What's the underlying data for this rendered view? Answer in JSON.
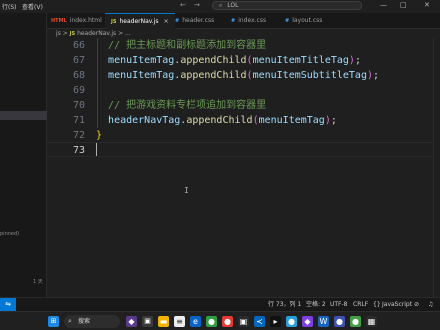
{
  "titlebar": {
    "menu_partial": "行(S)",
    "menu_view": "查看(V)",
    "nav_back": "←",
    "nav_forward": "→",
    "search_text": "LOL",
    "minimize": "—",
    "maximize": "□",
    "close": "✕"
  },
  "sidebar": {
    "label_partial": "pinned)",
    "date_label": "1 天"
  },
  "tabs": [
    {
      "icon": "HTML",
      "label": "index.html",
      "close": ""
    },
    {
      "icon": "JS",
      "label": "headerNav.js",
      "close": "×"
    },
    {
      "icon": "#",
      "label": "header.css",
      "close": ""
    },
    {
      "icon": "#",
      "label": "index.css",
      "close": ""
    },
    {
      "icon": "#",
      "label": "layout.css",
      "close": ""
    }
  ],
  "breadcrumb": {
    "folder": "js",
    "sep": ">",
    "file_icon": "JS",
    "file": "headerNav.js",
    "symbol": "> ..."
  },
  "editor": {
    "lines": [
      {
        "num": "66",
        "segments": [
          {
            "text": "  ",
            "cls": "pn"
          },
          {
            "text": "// 把主标题和副标题添加到容器里",
            "cls": "cm"
          }
        ]
      },
      {
        "num": "67",
        "segments": [
          {
            "text": "  ",
            "cls": "pn"
          },
          {
            "text": "menuItemTag",
            "cls": "vr"
          },
          {
            "text": ".",
            "cls": "pn"
          },
          {
            "text": "appendChild",
            "cls": "fn"
          },
          {
            "text": "(",
            "cls": "br"
          },
          {
            "text": "menuItemTitleTag",
            "cls": "vr"
          },
          {
            "text": ")",
            "cls": "br"
          },
          {
            "text": ";",
            "cls": "pn"
          }
        ]
      },
      {
        "num": "68",
        "segments": [
          {
            "text": "  ",
            "cls": "pn"
          },
          {
            "text": "menuItemTag",
            "cls": "vr"
          },
          {
            "text": ".",
            "cls": "pn"
          },
          {
            "text": "appendChild",
            "cls": "fn"
          },
          {
            "text": "(",
            "cls": "br"
          },
          {
            "text": "menuItemSubtitleTag",
            "cls": "vr"
          },
          {
            "text": ")",
            "cls": "br"
          },
          {
            "text": ";",
            "cls": "pn"
          }
        ]
      },
      {
        "num": "69",
        "segments": []
      },
      {
        "num": "70",
        "segments": [
          {
            "text": "  ",
            "cls": "pn"
          },
          {
            "text": "// 把游戏资料专栏项追加到容器里",
            "cls": "cm"
          }
        ]
      },
      {
        "num": "71",
        "segments": [
          {
            "text": "  ",
            "cls": "pn"
          },
          {
            "text": "headerNavTag",
            "cls": "vr"
          },
          {
            "text": ".",
            "cls": "pn"
          },
          {
            "text": "appendChild",
            "cls": "fn"
          },
          {
            "text": "(",
            "cls": "br"
          },
          {
            "text": "menuItemTag",
            "cls": "vr"
          },
          {
            "text": ")",
            "cls": "br"
          },
          {
            "text": ";",
            "cls": "pn"
          }
        ]
      },
      {
        "num": "72",
        "segments": [
          {
            "text": "}",
            "cls": "brace"
          }
        ]
      },
      {
        "num": "73",
        "segments": []
      }
    ],
    "current_line": "73"
  },
  "statusbar": {
    "position": "行 73，列 1",
    "indent": "空格: 2",
    "encoding": "UTF-8",
    "eol": "CRLF",
    "braces": "{}",
    "language": "JavaScript",
    "go_live": "⊘",
    "bell": "♫"
  },
  "taskbar": {
    "search_label": "搜索",
    "colors": {
      "accent": "#0078d4"
    }
  }
}
